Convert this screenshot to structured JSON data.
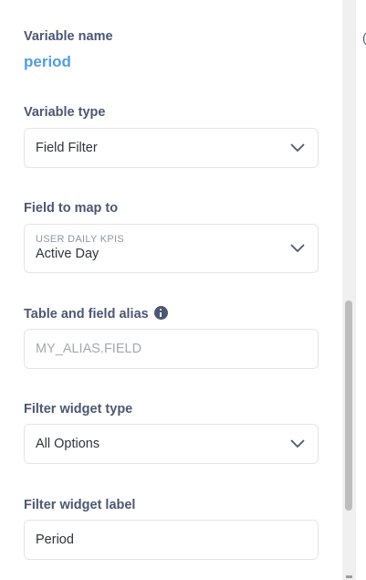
{
  "variable_name": {
    "label": "Variable name",
    "value": "period"
  },
  "variable_type": {
    "label": "Variable type",
    "selected": "Field Filter",
    "icon": "chevron-down-icon"
  },
  "field_to_map_to": {
    "label": "Field to map to",
    "table": "USER DAILY KPIS",
    "field": "Active Day",
    "icon": "chevron-down-icon"
  },
  "table_field_alias": {
    "label": "Table and field alias",
    "placeholder": "MY_ALIAS.FIELD",
    "value": "",
    "icon": "info-icon"
  },
  "filter_widget_type": {
    "label": "Filter widget type",
    "selected": "All Options",
    "icon": "chevron-down-icon"
  },
  "filter_widget_label": {
    "label": "Filter widget label",
    "value": "Period"
  },
  "edge_glyph": "(",
  "colors": {
    "label_text": "#4c5773",
    "variable_value": "#509ee3",
    "input_border": "#e2e5ea",
    "placeholder": "#a3a9b2"
  }
}
